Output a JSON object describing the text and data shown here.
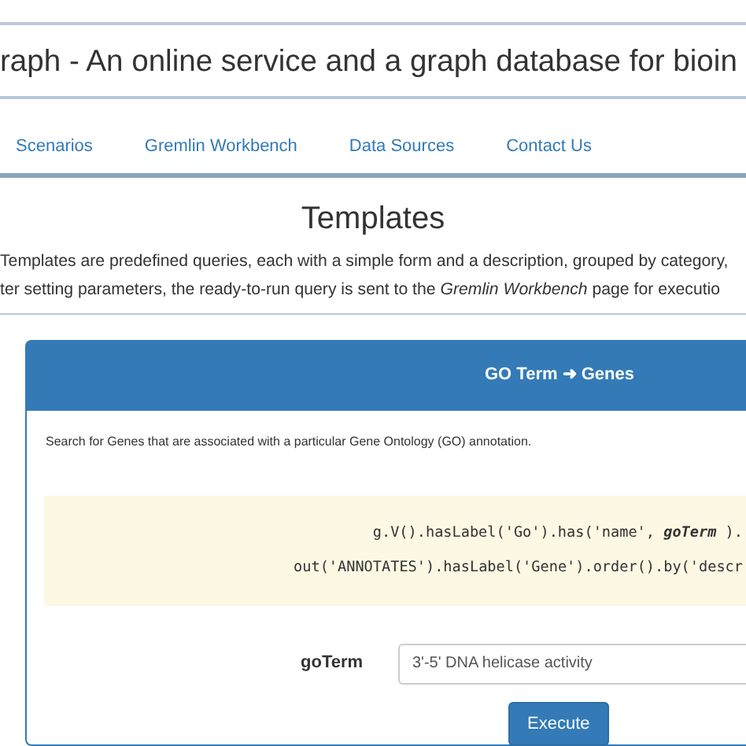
{
  "header": {
    "title": "raph - An online service and a graph database for bioin"
  },
  "nav": [
    {
      "label": "Scenarios"
    },
    {
      "label": "Gremlin Workbench"
    },
    {
      "label": "Data Sources"
    },
    {
      "label": "Contact Us"
    }
  ],
  "page": {
    "heading": "Templates",
    "intro": [
      "Templates are predefined queries, each with a simple form and a description, grouped by category,",
      "ter setting parameters, the ready-to-run query is sent to the *Gremlin Workbench* page for executio"
    ]
  },
  "template": {
    "title": "GO Term ➜ Genes",
    "description": "Search for Genes that are associated with a particular Gene Ontology (GO) annotation.",
    "query": [
      "g.V().hasLabel('Go').has('name', **goTerm** ).",
      "out('ANNOTATES').hasLabel('Gene').order().by('descr"
    ],
    "parameter": {
      "label": "goTerm",
      "value": "3'-5' DNA helicase activity"
    },
    "button": "Execute"
  }
}
